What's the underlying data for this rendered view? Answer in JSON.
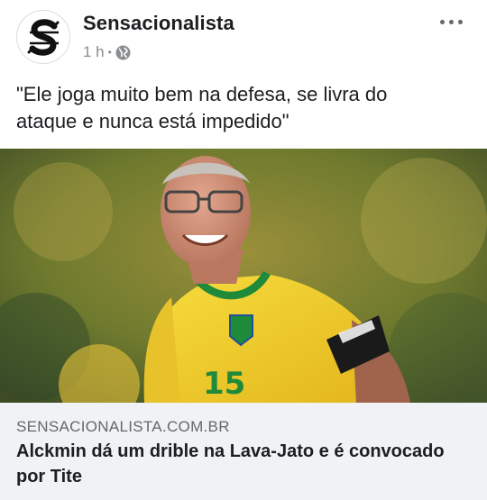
{
  "post": {
    "page_name": "Sensacionalista",
    "time": "1 h",
    "separator": "•",
    "privacy_icon": "globe-icon",
    "more_icon": "more-horizontal-icon",
    "text": "\"Ele joga muito bem na defesa, se livra do\nataque e nunca está impedido\""
  },
  "link": {
    "image_icon": "soccer-player-photo",
    "domain": "SENSACIONALISTA.COM.BR",
    "title": "Alckmin dá um drible na Lava-Jato e é convocado por Tite"
  },
  "colors": {
    "text": "#1c1e21",
    "secondary": "#8a8d91",
    "preview_bg": "#f0f2f5",
    "shirt": "#f6d32a",
    "collar": "#1f8a3a"
  }
}
